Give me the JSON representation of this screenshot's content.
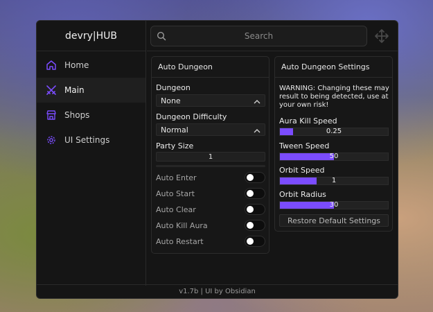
{
  "app": {
    "title": "devry|HUB",
    "footer": "v1.7b | UI by Obsidian"
  },
  "colors": {
    "accent": "#7b4cff",
    "nav_icon": "#7b4cff"
  },
  "sidebar": {
    "items": [
      {
        "label": "Home",
        "icon": "home-icon"
      },
      {
        "label": "Main",
        "icon": "swords-icon",
        "active": true
      },
      {
        "label": "Shops",
        "icon": "shop-icon"
      },
      {
        "label": "UI Settings",
        "icon": "gear-icon"
      }
    ]
  },
  "search": {
    "placeholder": "Search"
  },
  "auto_dungeon": {
    "title": "Auto Dungeon",
    "dungeon_label": "Dungeon",
    "dungeon_value": "None",
    "difficulty_label": "Dungeon Difficulty",
    "difficulty_value": "Normal",
    "party_label": "Party Size",
    "party_value": "1",
    "toggles": [
      {
        "label": "Auto Enter",
        "on": false
      },
      {
        "label": "Auto Start",
        "on": false
      },
      {
        "label": "Auto Clear",
        "on": false
      },
      {
        "label": "Auto Kill Aura",
        "on": false
      },
      {
        "label": "Auto Restart",
        "on": false
      }
    ]
  },
  "settings": {
    "title": "Auto Dungeon Settings",
    "warning": "WARNING: Changing these may result to being detected, use at your own risk!",
    "sliders": [
      {
        "label": "Aura Kill Speed",
        "value": "0.25",
        "fraction": 0.12
      },
      {
        "label": "Tween Speed",
        "value": "50",
        "fraction": 0.5
      },
      {
        "label": "Orbit Speed",
        "value": "1",
        "fraction": 0.34
      },
      {
        "label": "Orbit Radius",
        "value": "30",
        "fraction": 0.5
      }
    ],
    "restore_label": "Restore Default Settings"
  }
}
